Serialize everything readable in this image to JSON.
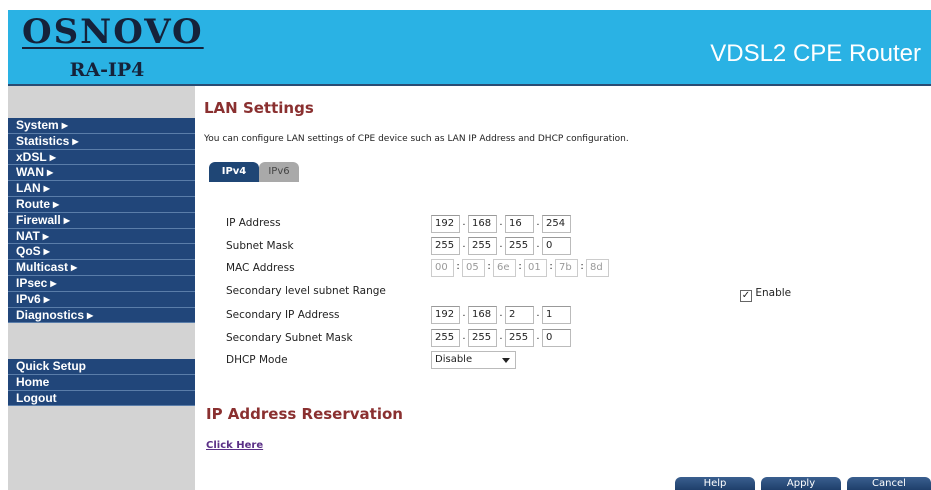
{
  "header": {
    "brand": "OSNOVO",
    "model": "RA-IP4",
    "product_title": "VDSL2 CPE Router"
  },
  "sidebar": {
    "items": [
      {
        "label": "System",
        "arrow": "▶"
      },
      {
        "label": "Statistics",
        "arrow": "▶"
      },
      {
        "label": "xDSL",
        "arrow": "▶"
      },
      {
        "label": "WAN",
        "arrow": "▶"
      },
      {
        "label": "LAN",
        "arrow": "▶"
      },
      {
        "label": "Route",
        "arrow": "▶"
      },
      {
        "label": "Firewall",
        "arrow": "▶"
      },
      {
        "label": "NAT",
        "arrow": "▶"
      },
      {
        "label": "QoS",
        "arrow": "▶"
      },
      {
        "label": "Multicast",
        "arrow": "▶"
      },
      {
        "label": "IPsec",
        "arrow": "▶"
      },
      {
        "label": "IPv6",
        "arrow": "▶"
      },
      {
        "label": "Diagnostics",
        "arrow": "▶"
      }
    ],
    "quick_items": [
      {
        "label": "Quick Setup"
      },
      {
        "label": "Home"
      },
      {
        "label": "Logout"
      }
    ]
  },
  "main": {
    "title": "LAN Settings",
    "description": "You can configure LAN settings of CPE device such as LAN IP Address and DHCP configuration.",
    "tabs": [
      {
        "label": "IPv4",
        "active": true
      },
      {
        "label": "IPv6",
        "active": false
      }
    ],
    "form": {
      "ip_address": {
        "label": "IP Address",
        "octets": [
          "192",
          "168",
          "16",
          "254"
        ]
      },
      "subnet_mask": {
        "label": "Subnet Mask",
        "octets": [
          "255",
          "255",
          "255",
          "0"
        ]
      },
      "mac_address": {
        "label": "MAC Address",
        "octets": [
          "00",
          "05",
          "6e",
          "01",
          "7b",
          "8d"
        ]
      },
      "secondary_range": {
        "label": "Secondary level subnet Range",
        "enable_label": "Enable",
        "enable_checked": true,
        "check_glyph": "✓"
      },
      "secondary_ip": {
        "label": "Secondary IP Address",
        "octets": [
          "192",
          "168",
          "2",
          "1"
        ]
      },
      "secondary_mask": {
        "label": "Secondary Subnet Mask",
        "octets": [
          "255",
          "255",
          "255",
          "0"
        ]
      },
      "dhcp_mode": {
        "label": "DHCP Mode",
        "value": "Disable"
      }
    },
    "reservation": {
      "title": "IP Address Reservation",
      "link": "Click Here"
    },
    "buttons": {
      "help": "Help",
      "apply": "Apply",
      "cancel": "Cancel"
    }
  },
  "colors": {
    "header_bg": "#2ab2e4",
    "nav_bg": "#21467a",
    "sidebar_bg": "#d3d3d3",
    "title_red": "#8a3030"
  }
}
